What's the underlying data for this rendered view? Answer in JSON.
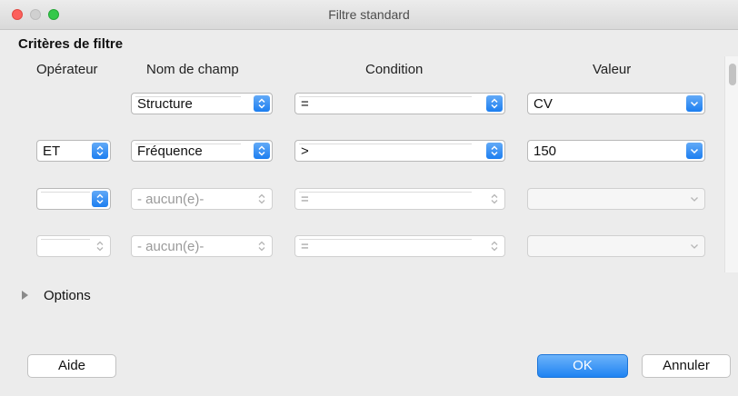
{
  "window": {
    "title": "Filtre standard"
  },
  "section_title": "Critères de filtre",
  "columns": {
    "operator": "Opérateur",
    "field": "Nom de champ",
    "condition": "Condition",
    "value": "Valeur"
  },
  "rows": [
    {
      "operator": "",
      "field": "Structure",
      "condition": "=",
      "value": "CV"
    },
    {
      "operator": "ET",
      "field": "Fréquence",
      "condition": ">",
      "value": "150"
    },
    {
      "operator": "",
      "field": "- aucun(e)-",
      "condition": "=",
      "value": ""
    },
    {
      "operator": "",
      "field": "- aucun(e)-",
      "condition": "=",
      "value": ""
    }
  ],
  "options": {
    "label": "Options"
  },
  "buttons": {
    "help": "Aide",
    "ok": "OK",
    "cancel": "Annuler"
  },
  "colors": {
    "accent": "#1c7ef0",
    "close": "#fc605c",
    "maximize": "#34c84a"
  },
  "icons": [
    "updown-chevron-icon",
    "chevron-down-icon",
    "disclosure-triangle-icon"
  ]
}
